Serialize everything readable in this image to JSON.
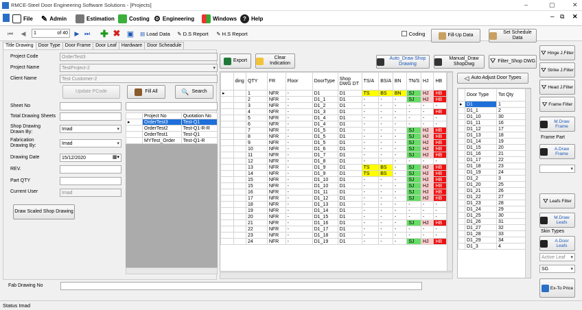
{
  "window": {
    "title": "RMCE-Steel Door Engineering Software Solutions - [Projects]",
    "min": "–",
    "max": "▢",
    "close": "✕",
    "restore": "⧉",
    "inner_min": "–",
    "inner_close": "✕"
  },
  "menu": {
    "file": "File",
    "admin": "Admin",
    "estimation": "Estimation",
    "costing": "Costing",
    "engineering": "Engineering",
    "windows": "Windows",
    "help": "Help"
  },
  "toolbar": {
    "page": "1",
    "of": "of 40",
    "load_data": "Load Data",
    "ds_report": "D.S Report",
    "hs_report": "H.S Report",
    "coding": "Coding",
    "fill_up": "Fill-Up Data",
    "schedule": "Set Schedule Data"
  },
  "tabs": [
    "Title Drawing",
    "Door Type",
    "Door Frame",
    "Door Leaf",
    "Hardware",
    "Door Scheadule"
  ],
  "form": {
    "project_code_label": "Project Code",
    "project_code": "OrderTest3",
    "project_name_label": "Project Name",
    "project_name": "TestProject-2",
    "client_name_label": "Client Name",
    "client_name": "Test Customer-2",
    "update_btn": "Update PCode",
    "fill_all": "Fill All",
    "search": "Search",
    "sheet_no_label": "Sheet No",
    "total_sheets_label": "Total Drawing Sheets",
    "shop_by_label": "Shop Drawing Drawn By:",
    "shop_by": "Imad",
    "fab_by_label": "Fabrication Drawing By:",
    "fab_by": "Imad",
    "date_label": "Drawing Date",
    "date": "15/12/2020",
    "rev_label": "REV.",
    "part_qty_label": "Part QTY",
    "current_user_label": "Current User",
    "current_user": "Imad",
    "draw_scaled": "Draw Scaled Shop Drawing",
    "fab_no_label": "Fab Drawing No"
  },
  "projects": {
    "headers": [
      "Project No",
      "Quotation No"
    ],
    "rows": [
      [
        "OrderTest3",
        "Test-Q1"
      ],
      [
        "OrderTest2",
        "Test-Q1-R-R"
      ],
      [
        "OrderTest1",
        "Test-Q1"
      ],
      [
        "MYTest_Order",
        "Test-Q1-R"
      ]
    ]
  },
  "actions": {
    "export": "Export",
    "clear": "Clear Indication",
    "auto_draw": "Auto_Draw Shop Drawing",
    "manual_draw": "Manual_Draw ShopDwg",
    "filter_shop": "Filter_Shop DWG",
    "auto_adjust": "Auto Adjust Door Types"
  },
  "main_grid": {
    "headers": [
      "ding",
      "QTY",
      "FR",
      "Floor",
      "DoorType",
      "Shop DWG DT",
      "TS/A",
      "BS/A",
      "BN",
      "TN/S",
      "HJ",
      "HB"
    ],
    "rows": [
      [
        "",
        "1",
        "NFR",
        "-",
        "D1",
        "D1",
        "TS",
        "BS",
        "BN",
        "SJ",
        "HJ",
        "HB"
      ],
      [
        "",
        "2",
        "NFR",
        "-",
        "D1_1",
        "D1",
        "-",
        "-",
        "-",
        "SJ",
        "HJ",
        "HB"
      ],
      [
        "",
        "3",
        "NFR",
        "-",
        "D1_2",
        "D1",
        "-",
        "-",
        "-",
        "-",
        "-",
        "-"
      ],
      [
        "",
        "4",
        "NFR",
        "-",
        "D1_3",
        "D1",
        "-",
        "-",
        "-",
        "-",
        "-",
        "HB"
      ],
      [
        "",
        "5",
        "NFR",
        "-",
        "D1_4",
        "D1",
        "-",
        "-",
        "-",
        "-",
        "-",
        "-"
      ],
      [
        "",
        "6",
        "NFR",
        "-",
        "D1_4",
        "D1",
        "-",
        "-",
        "-",
        "-",
        "-",
        "-"
      ],
      [
        "",
        "7",
        "NFR",
        "-",
        "D1_5",
        "D1",
        "-",
        "-",
        "-",
        "SJ",
        "HJ",
        "HB"
      ],
      [
        "",
        "8",
        "NFR",
        "-",
        "D1_5",
        "D1",
        "-",
        "-",
        "-",
        "SJ",
        "HJ",
        "HB"
      ],
      [
        "",
        "9",
        "NFR",
        "-",
        "D1_5",
        "D1",
        "-",
        "-",
        "-",
        "SJ",
        "HJ",
        "HB"
      ],
      [
        "",
        "10",
        "NFR",
        "-",
        "D1_6",
        "D1",
        "-",
        "-",
        "-",
        "SJ",
        "HJ",
        "HB"
      ],
      [
        "",
        "11",
        "NFR",
        "-",
        "D1_7",
        "D1",
        "-",
        "-",
        "-",
        "SJ",
        "HJ",
        "HB"
      ],
      [
        "",
        "12",
        "NFR",
        "-",
        "D1_8",
        "D1",
        "-",
        "-",
        "-",
        "-",
        "-",
        "-"
      ],
      [
        "",
        "13",
        "NFR",
        "-",
        "D1_9",
        "D1",
        "TS",
        "BS",
        "-",
        "SJ",
        "HJ",
        "HB"
      ],
      [
        "",
        "14",
        "NFR",
        "-",
        "D1_9",
        "D1",
        "TS",
        "BS",
        "-",
        "SJ",
        "HJ",
        "HB"
      ],
      [
        "",
        "15",
        "NFR",
        "-",
        "D1_10",
        "D1",
        "-",
        "-",
        "-",
        "SJ",
        "HJ",
        "HB"
      ],
      [
        "",
        "15",
        "NFR",
        "-",
        "D1_10",
        "D1",
        "-",
        "-",
        "-",
        "SJ",
        "HJ",
        "HB"
      ],
      [
        "",
        "16",
        "NFR",
        "-",
        "D1_11",
        "D1",
        "-",
        "-",
        "-",
        "SJ",
        "HJ",
        "HB"
      ],
      [
        "",
        "17",
        "NFR",
        "-",
        "D1_12",
        "D1",
        "-",
        "-",
        "-",
        "SJ",
        "HJ",
        "HB"
      ],
      [
        "",
        "18",
        "NFR",
        "-",
        "D1_13",
        "D1",
        "-",
        "-",
        "-",
        "-",
        "-",
        "-"
      ],
      [
        "",
        "19",
        "NFR",
        "-",
        "D1_14",
        "D1",
        "-",
        "-",
        "-",
        "-",
        "-",
        "-"
      ],
      [
        "",
        "20",
        "NFR",
        "-",
        "D1_15",
        "D1",
        "-",
        "-",
        "-",
        "-",
        "-",
        "-"
      ],
      [
        "",
        "21",
        "NFR",
        "-",
        "D1_16",
        "D1",
        "-",
        "-",
        "-",
        "SJ",
        "HJ",
        "HB"
      ],
      [
        "",
        "22",
        "NFR",
        "-",
        "D1_17",
        "D1",
        "-",
        "-",
        "-",
        "-",
        "-",
        "-"
      ],
      [
        "",
        "23",
        "NFR",
        "-",
        "D1_18",
        "D1",
        "-",
        "-",
        "-",
        "-",
        "-",
        "-"
      ],
      [
        "",
        "24",
        "NFR",
        "-",
        "D1_19",
        "D1",
        "-",
        "-",
        "-",
        "SJ",
        "HJ",
        "HB"
      ]
    ]
  },
  "door_types": {
    "headers": [
      "Door Type",
      "Tot Qty"
    ],
    "rows": [
      [
        "D1",
        "1"
      ],
      [
        "D1_1",
        "2"
      ],
      [
        "D1_10",
        "30"
      ],
      [
        "D1_11",
        "16"
      ],
      [
        "D1_12",
        "17"
      ],
      [
        "D1_13",
        "18"
      ],
      [
        "D1_14",
        "19"
      ],
      [
        "D1_15",
        "20"
      ],
      [
        "D1_16",
        "21"
      ],
      [
        "D1_17",
        "22"
      ],
      [
        "D1_18",
        "23"
      ],
      [
        "D1_19",
        "24"
      ],
      [
        "D1_2",
        "3"
      ],
      [
        "D1_20",
        "25"
      ],
      [
        "D1_21",
        "26"
      ],
      [
        "D1_22",
        "27"
      ],
      [
        "D1_23",
        "28"
      ],
      [
        "D1_24",
        "29"
      ],
      [
        "D1_25",
        "30"
      ],
      [
        "D1_26",
        "31"
      ],
      [
        "D1_27",
        "32"
      ],
      [
        "D1_28",
        "33"
      ],
      [
        "D1_29",
        "34"
      ],
      [
        "D1_3",
        "4"
      ]
    ]
  },
  "right_panel": {
    "hinge": "Hinge J.Filter",
    "strike": "Strike J.Filter",
    "head": "Head J.Filter",
    "frame_filter": "Frame Filter",
    "m_draw_frame": "M.Draw Frame",
    "frame_part": "Frame Part",
    "a_draw_frame": "A.Draw Frame",
    "leafs_filter": "Leafs Filter",
    "m_draw_leafs": "M.Draw Leafs",
    "skin_types": "Skin Types",
    "a_door_leafs": "A.Door Leafs",
    "active_leaf": "Active Leaf",
    "sg": "SG",
    "ex_to_price": "Ex-To Price"
  },
  "status": {
    "text": "Status  Imad"
  }
}
